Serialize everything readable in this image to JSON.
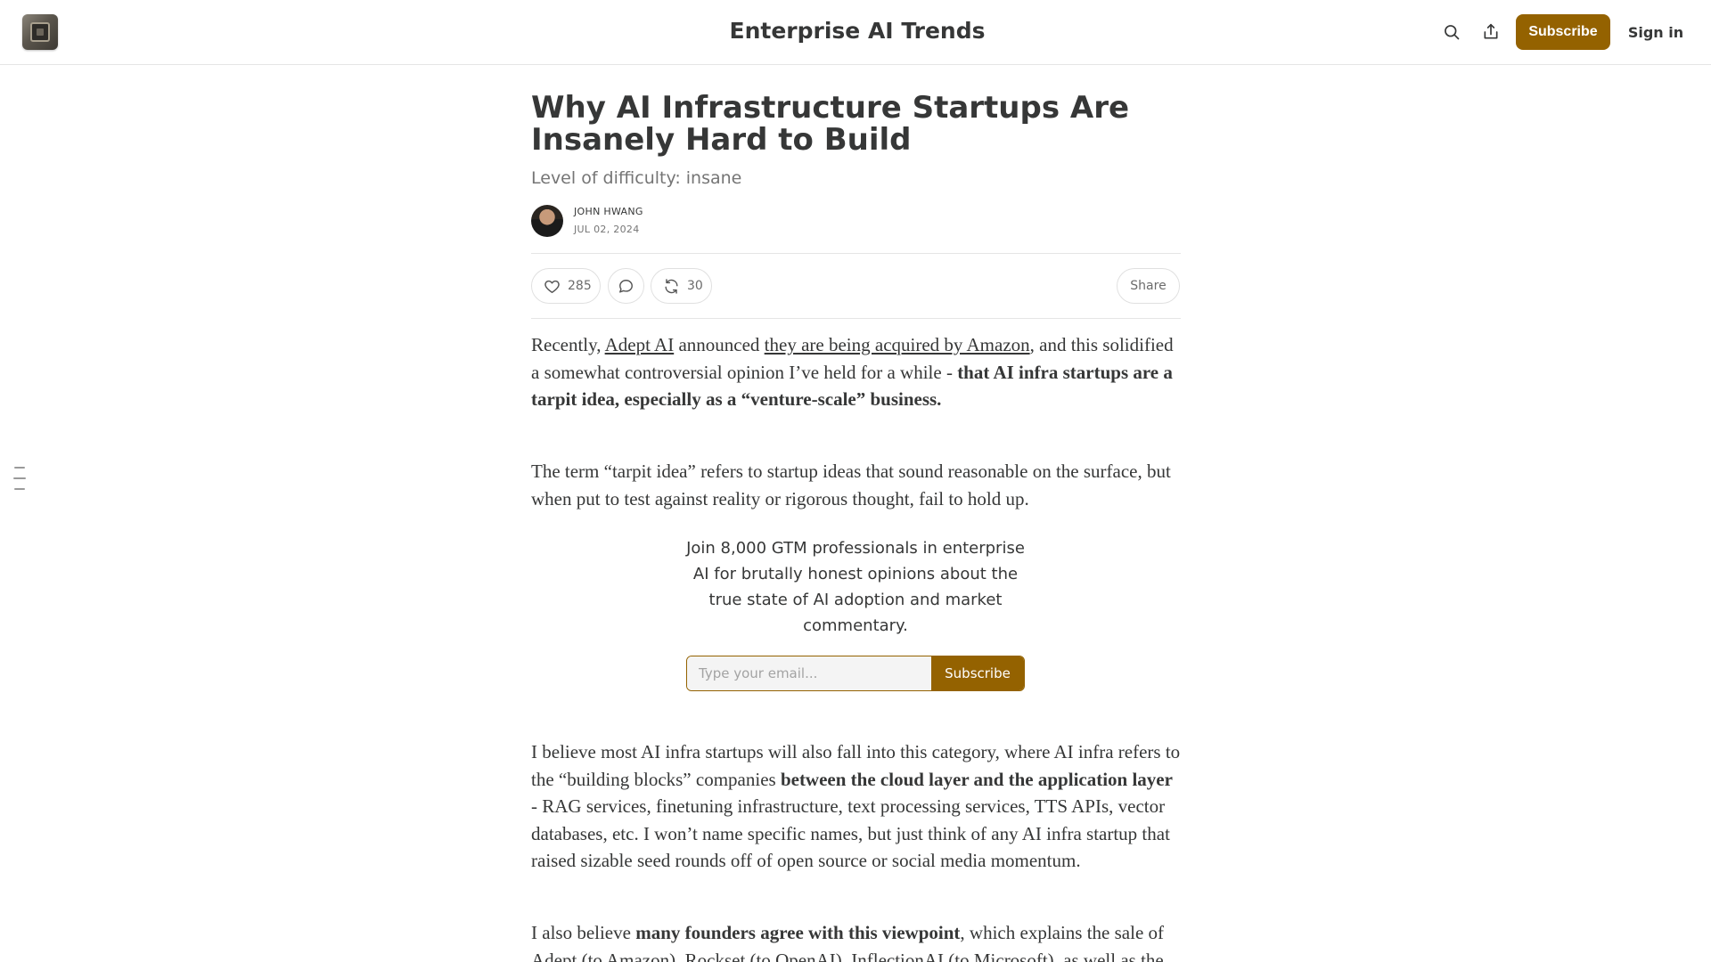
{
  "header": {
    "publication_title": "Enterprise AI Trends",
    "subscribe_label": "Subscribe",
    "signin_label": "Sign in",
    "icons": [
      "search-icon",
      "share-icon"
    ]
  },
  "article": {
    "title": "Why AI Infrastructure Startups Are Insanely Hard to Build",
    "subtitle": "Level of difficulty: insane",
    "author": "JOHN HWANG",
    "date": "JUL 02, 2024",
    "likes": "285",
    "restacks": "30",
    "share_label": "Share",
    "p1": {
      "t1": "Recently, ",
      "link1": "Adept AI",
      "t2": " announced ",
      "link2": "they are being acquired by Amazon",
      "t3": ", and this solidified a somewhat controversial opinion I’ve held for a while - ",
      "bold": "that AI infra startups are a tarpit idea, especially as a “venture-scale” business."
    },
    "p2": "The term “tarpit idea” refers to startup ideas that sound reasonable on the surface, but when put to test against reality or rigorous thought, fail to hold up.",
    "p3": {
      "t1": "I believe most AI infra startups will also fall into this category, where AI infra refers to the “building blocks” companies ",
      "bold": "between the cloud layer and the application layer",
      "t2": " - RAG services, finetuning infrastructure, text processing services, TTS APIs, vector databases, etc. I won’t name specific names, but just think of any AI infra startup that raised sizable seed rounds off of open source or social media momentum."
    },
    "p4": {
      "t1": "I also believe ",
      "bold": "many founders agree with this viewpoint",
      "t2": ", which explains the sale of Adept (to Amazon), Rockset (to OpenAI), InflectionAI (to Microsoft), as well as the"
    }
  },
  "subscribe_widget": {
    "text": "Join 8,000 GTM professionals in enterprise AI for brutally honest opinions about the true state of AI adoption and market commentary.",
    "placeholder": "Type your email...",
    "button_label": "Subscribe"
  },
  "colors": {
    "accent": "#946200",
    "text": "#363737",
    "muted": "#757575",
    "divider": "#e5e5e5"
  }
}
